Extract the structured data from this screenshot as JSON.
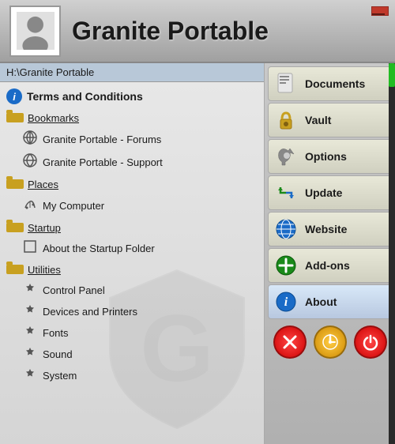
{
  "header": {
    "title": "Granite Portable",
    "minimize_label": "—"
  },
  "path_bar": {
    "text": "H:\\Granite Portable"
  },
  "nav": {
    "top_item": {
      "label": "Terms and Conditions",
      "icon": "ℹ"
    },
    "sections": [
      {
        "id": "bookmarks",
        "label": "Bookmarks",
        "items": [
          {
            "label": "Granite Portable - Forums",
            "icon": "↺"
          },
          {
            "label": "Granite Portable - Support",
            "icon": "↺"
          }
        ]
      },
      {
        "id": "places",
        "label": "Places",
        "items": [
          {
            "label": "My Computer",
            "icon": "🔧"
          }
        ]
      },
      {
        "id": "startup",
        "label": "Startup",
        "items": [
          {
            "label": "About the Startup Folder",
            "icon": "☐"
          }
        ]
      },
      {
        "id": "utilities",
        "label": "Utilities",
        "items": [
          {
            "label": "Control Panel",
            "icon": "🔧"
          },
          {
            "label": "Devices and Printers",
            "icon": "🔧"
          },
          {
            "label": "Fonts",
            "icon": "🔧"
          },
          {
            "label": "Sound",
            "icon": "🔧"
          },
          {
            "label": "System",
            "icon": "🔧"
          }
        ]
      }
    ]
  },
  "right_panel": {
    "buttons": [
      {
        "id": "documents",
        "label": "Documents",
        "icon": "📄"
      },
      {
        "id": "vault",
        "label": "Vault",
        "icon": "🔒"
      },
      {
        "id": "options",
        "label": "Options",
        "icon": "🔧"
      },
      {
        "id": "update",
        "label": "Update",
        "icon": "🔄"
      },
      {
        "id": "website",
        "label": "Website",
        "icon": "🌐"
      },
      {
        "id": "addons",
        "label": "Add-ons",
        "icon": "➕"
      },
      {
        "id": "about",
        "label": "About",
        "icon": "ℹ"
      }
    ],
    "bottom_buttons": [
      {
        "id": "exit",
        "label": "✕",
        "type": "exit"
      },
      {
        "id": "sleep",
        "label": "⏻",
        "type": "sleep"
      },
      {
        "id": "power",
        "label": "⏻",
        "type": "power"
      }
    ]
  },
  "watermark": "G"
}
